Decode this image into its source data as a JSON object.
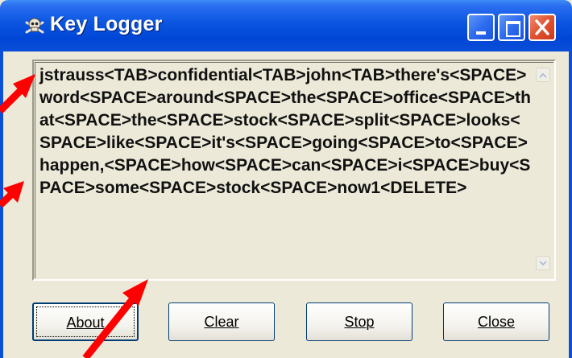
{
  "window": {
    "title": "Key Logger",
    "icon": "skull-crossbones-icon",
    "controls": [
      "minimize",
      "maximize",
      "close"
    ]
  },
  "log": {
    "text": "jstrauss<TAB>confidential<TAB>john<TAB>there's<SPACE>word<SPACE>around<SPACE>the<SPACE>office<SPACE>that<SPACE>the<SPACE>stock<SPACE>split<SPACE>looks<SPACE>like<SPACE>it's<SPACE>going<SPACE>to<SPACE>happen,<SPACE>how<SPACE>can<SPACE>i<SPACE>buy<SPACE>some<SPACE>stock<SPACE>now1<DELETE>"
  },
  "buttons": {
    "about": "About",
    "clear": "Clear",
    "stop": "Stop",
    "close": "Close"
  },
  "colors": {
    "titlebar": "#0a55e0",
    "window_bg": "#ece9d8",
    "annotation_arrows": "#ff0000"
  }
}
